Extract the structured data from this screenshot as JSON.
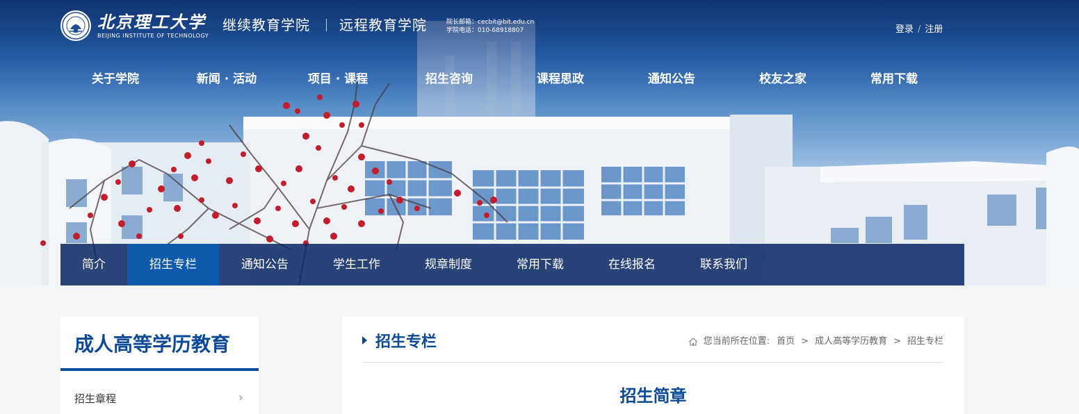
{
  "header": {
    "logo_cn": "北京理工大学",
    "logo_en": "BEIJING INSTITUTE OF TECHNOLOGY",
    "college_1": "继续教育学院",
    "college_2": "远程教育学院",
    "contact_email": "院长邮箱：cecbit@bit.edu.cn",
    "contact_phone": "学院电话：010-68918807",
    "login": "登录",
    "auth_sep": "/",
    "register": "注册"
  },
  "main_nav": [
    {
      "label": "关于学院"
    },
    {
      "label": "新闻 · 活动"
    },
    {
      "label": "项目 · 课程"
    },
    {
      "label": "招生咨询"
    },
    {
      "label": "课程思政"
    },
    {
      "label": "通知公告"
    },
    {
      "label": "校友之家"
    },
    {
      "label": "常用下载"
    }
  ],
  "sub_nav": [
    {
      "label": "简介"
    },
    {
      "label": "招生专栏",
      "active": true
    },
    {
      "label": "通知公告"
    },
    {
      "label": "学生工作"
    },
    {
      "label": "规章制度"
    },
    {
      "label": "常用下载"
    },
    {
      "label": "在线报名"
    },
    {
      "label": "联系我们"
    }
  ],
  "sidebar": {
    "title": "成人高等学历教育",
    "items": [
      {
        "label": "招生章程"
      }
    ]
  },
  "panel": {
    "title": "招生专栏",
    "breadcrumb": {
      "prefix": "您当前所在位置:",
      "items": [
        "首页",
        "成人高等学历教育",
        "招生专栏"
      ],
      "separator": ">"
    },
    "article_title": "招生简章"
  },
  "colors": {
    "brand_blue": "#0b4a97",
    "active_tab": "#0e5bad",
    "subnav_bg": "#0a2864",
    "page_bg": "#f4f5f7"
  },
  "icons": [
    "seal-logo-icon",
    "home-icon",
    "chevron-right-icon"
  ]
}
